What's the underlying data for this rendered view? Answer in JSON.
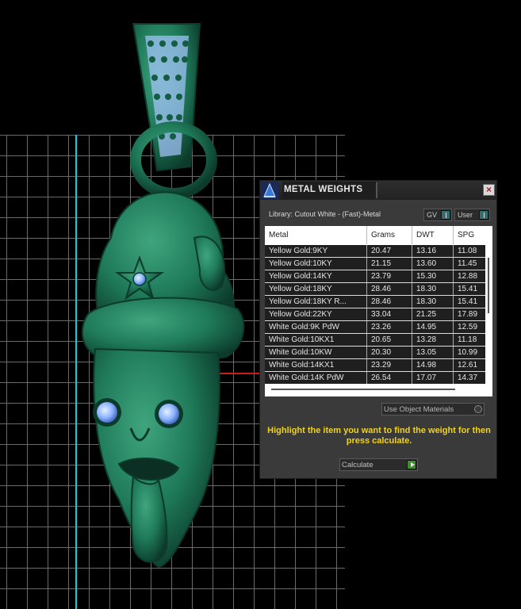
{
  "panel": {
    "title": "METAL WEIGHTS",
    "close": "×",
    "library_label": "Library: Cutout White - (Fast)-Metal",
    "toggles": [
      {
        "label": "GV",
        "on": true
      },
      {
        "label": "User",
        "on": true
      }
    ],
    "table": {
      "columns": [
        "Metal",
        "Grams",
        "DWT",
        "SPG"
      ],
      "rows": [
        [
          "Yellow Gold:9KY",
          "20.47",
          "13.16",
          "11.08"
        ],
        [
          "Yellow Gold:10KY",
          "21.15",
          "13.60",
          "11.45"
        ],
        [
          "Yellow Gold:14KY",
          "23.79",
          "15.30",
          "12.88"
        ],
        [
          "Yellow Gold:18KY",
          "28.46",
          "18.30",
          "15.41"
        ],
        [
          "Yellow Gold:18KY R...",
          "28.46",
          "18.30",
          "15.41"
        ],
        [
          "Yellow Gold:22KY",
          "33.04",
          "21.25",
          "17.89"
        ],
        [
          "White Gold:9K PdW",
          "23.26",
          "14.95",
          "12.59"
        ],
        [
          "White Gold:10KX1",
          "20.65",
          "13.28",
          "11.18"
        ],
        [
          "White Gold:10KW",
          "20.30",
          "13.05",
          "10.99"
        ],
        [
          "White Gold:14KX1",
          "23.29",
          "14.98",
          "12.61"
        ],
        [
          "White Gold:14K PdW",
          "26.54",
          "17.07",
          "14.37"
        ]
      ]
    },
    "use_object_materials": "Use Object Materials",
    "hint": "Highlight the item you want to find the weight for then press calculate.",
    "calculate": "Calculate"
  },
  "colors": {
    "model_green": "#1f7a5a",
    "gem_blue": "#8fb6ff",
    "hint_yellow": "#f2d21a",
    "grid": "#6a6a6a"
  }
}
